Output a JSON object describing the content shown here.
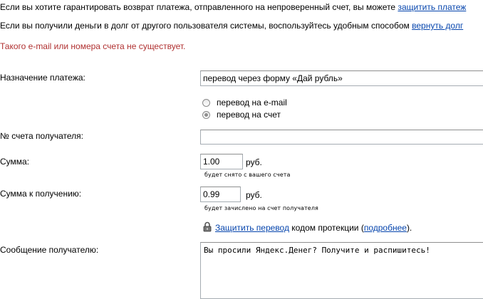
{
  "notices": {
    "refund_text": "Если вы хотите гарантировать возврат платежа, отправленного на непроверенный счет, вы можете ",
    "refund_link": "защитить платеж",
    "debt_text": "Если вы получили деньги в долг от другого пользователя системы, воспользуйтесь удобным способом ",
    "debt_link": "вернуть долг"
  },
  "error": "Такого e-mail или номера счета не существует.",
  "form": {
    "purpose_label": "Назначение платежа:",
    "purpose_value": "перевод через форму «Дай рубль»",
    "radio_email": "перевод на e-mail",
    "radio_account": "перевод на счет",
    "selected_radio": "account",
    "account_label": "№ счета получателя:",
    "account_value": "",
    "amount_label": "Сумма:",
    "amount_value": "1.00",
    "amount_unit": "руб.",
    "amount_hint": "будет снято с вашего счета",
    "receive_label": "Сумма к получению:",
    "receive_value": "0.99",
    "receive_unit": "руб.",
    "receive_hint": "будет зачислено на счет получателя",
    "protect_link": "Защитить перевод",
    "protect_text_mid": " кодом протекции (",
    "protect_more_link": "подробнее",
    "protect_text_end": ").",
    "message_label": "Сообщение получателю:",
    "message_value": "Вы просили Яндекс.Денег? Получите и распишитесь!"
  },
  "icons": {
    "lock": "lock-icon"
  },
  "colors": {
    "link": "#0645ad",
    "error": "#b03030"
  }
}
